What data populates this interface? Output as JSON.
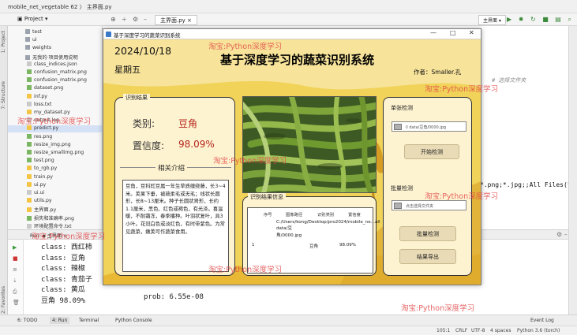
{
  "ide": {
    "breadcrumb": "mobile_net_vegetable 62 〉 主界面.py",
    "project_label": "Project",
    "editor_tab": "主界面.py",
    "run_config": "主界面",
    "code_comment": "# 选择文件夹",
    "code_line": "*.png;*.jpg;;All Files(*",
    "run_tab_title": "主界面",
    "tree": [
      {
        "label": "test",
        "type": "folder"
      },
      {
        "label": "ui",
        "type": "folder"
      },
      {
        "label": "weights",
        "type": "folder"
      },
      {
        "label": "无我的·项目使用说明",
        "type": "folder"
      },
      {
        "label": "class_indices.json",
        "type": "txt"
      },
      {
        "label": "confusion_matrix.png",
        "type": "img"
      },
      {
        "label": "confusion_matrix.png",
        "type": "img"
      },
      {
        "label": "dataset.png",
        "type": "img"
      },
      {
        "label": "inf.py",
        "type": "py"
      },
      {
        "label": "loss.txt",
        "type": "txt"
      },
      {
        "label": "my_dataset.py",
        "type": "py"
      },
      {
        "label": "output.log",
        "type": "txt"
      },
      {
        "label": "predict.py",
        "type": "py",
        "selected": true
      },
      {
        "label": "res.png",
        "type": "img"
      },
      {
        "label": "resize_img.png",
        "type": "img"
      },
      {
        "label": "resize_smallimg.png",
        "type": "img"
      },
      {
        "label": "test.png",
        "type": "img"
      },
      {
        "label": "to_rgb.py",
        "type": "py"
      },
      {
        "label": "train.py",
        "type": "py"
      },
      {
        "label": "ui.py",
        "type": "py"
      },
      {
        "label": "ui.ui",
        "type": "txt"
      },
      {
        "label": "utils.py",
        "type": "py"
      },
      {
        "label": "主界面.py",
        "type": "py"
      },
      {
        "label": "损失和准确率.png",
        "type": "img"
      },
      {
        "label": "环境配置命令.txt",
        "type": "txt"
      }
    ],
    "run_output": [
      "class: 西红柿",
      "class: 豆角",
      "class: 辣椒",
      "class: 青茄子",
      "class: 黄瓜",
      "豆角 98.09%"
    ],
    "run_prob": "prob: 6.55e-08",
    "bottom_tabs": [
      "6: TODO",
      "4: Run",
      "Terminal",
      "Python Console"
    ],
    "status": {
      "position": "105:1",
      "line_sep": "CRLF",
      "encoding": "UTF-8",
      "indent": "4 spaces",
      "interpreter": "Python 3.6 (torch)",
      "event_log": "Event Log"
    }
  },
  "app": {
    "window_title": "基于深度学习的蔬菜识别系统",
    "date": "2024/10/18",
    "weekday": "星期五",
    "title": "基于深度学习的蔬菜识别系统",
    "author": "作者：Smaller.孔",
    "result_section": "识别结果",
    "class_label": "类别:",
    "class_value": "豆角",
    "confidence_label": "置信度:",
    "confidence_value": "98.09%",
    "intro_label": "相关介绍",
    "description": "豆角，豆科豇豆属一年生草质缠绕藤，长3~4米。荚果下垂，被疏柔毛或无毛；线状长圆形，长8~13厘米。种子长圆状肾形，长约1.1厘米，黑色、红色或褐色，有光泽。喜温暖，不耐霜冻，春季播种。叶羽状复叶，具3小叶。花冠白色或淡红色，有时带紫色。为常见蔬菜，嫩荚可作蔬菜食用。",
    "table_section": "识别结果信息",
    "table_headers": [
      "序号",
      "图像路径",
      "识别类别",
      "置信度"
    ],
    "table_rows": [
      {
        "index": "1",
        "path": "C:/Users/kong/Desktop/pro2024/mobile_ne...all data/豆角/0000.jpg",
        "class": "豆角",
        "confidence": "98.09%"
      }
    ],
    "single_section": "单张检测",
    "single_path": "ll data/豆角/0000.jpg",
    "start_button": "开始检测",
    "batch_section": "批量检测",
    "batch_placeholder": "点击选择文件夹",
    "batch_button": "批量检测",
    "export_button": "结果导出"
  },
  "watermark": "淘宝:Python深度学习",
  "colors": {
    "accent_red": "#b3251c",
    "app_yellow": "#f1d35a",
    "panel_cream": "#fef3d1"
  }
}
